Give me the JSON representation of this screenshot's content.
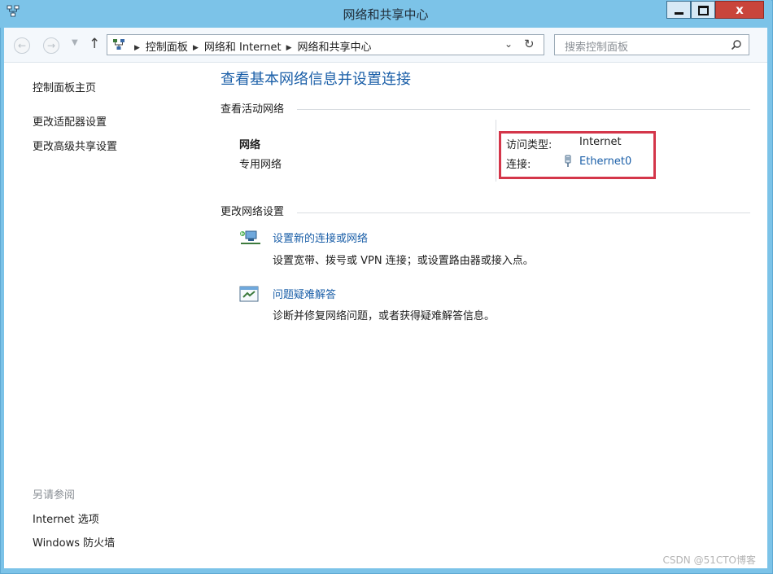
{
  "window": {
    "title": "网络和共享中心",
    "close_glyph": "x"
  },
  "toolbar": {
    "breadcrumbs": [
      "控制面板",
      "网络和 Internet",
      "网络和共享中心"
    ],
    "search_placeholder": "搜索控制面板"
  },
  "sidebar": {
    "links": [
      "控制面板主页",
      "更改适配器设置",
      "更改高级共享设置"
    ],
    "see_also_title": "另请参阅",
    "see_also_links": [
      "Internet 选项",
      "Windows 防火墙"
    ]
  },
  "main": {
    "title": "查看基本网络信息并设置连接",
    "active_networks_heading": "查看活动网络",
    "network": {
      "name": "网络",
      "type": "专用网络",
      "access_type_label": "访问类型:",
      "access_type_value": "Internet",
      "connection_label": "连接:",
      "connection_value": "Ethernet0"
    },
    "change_settings_heading": "更改网络设置",
    "tasks": [
      {
        "link": "设置新的连接或网络",
        "description": "设置宽带、拨号或 VPN 连接；或设置路由器或接入点。",
        "icon": "new-connection-icon"
      },
      {
        "link": "问题疑难解答",
        "description": "诊断并修复网络问题，或者获得疑难解答信息。",
        "icon": "troubleshoot-icon"
      }
    ]
  },
  "watermark": "CSDN @51CTO博客",
  "colors": {
    "window_frame": "#7cc3e8",
    "link": "#1b5fa8",
    "highlight_box": "#d4364a",
    "close_button": "#c9453b"
  }
}
